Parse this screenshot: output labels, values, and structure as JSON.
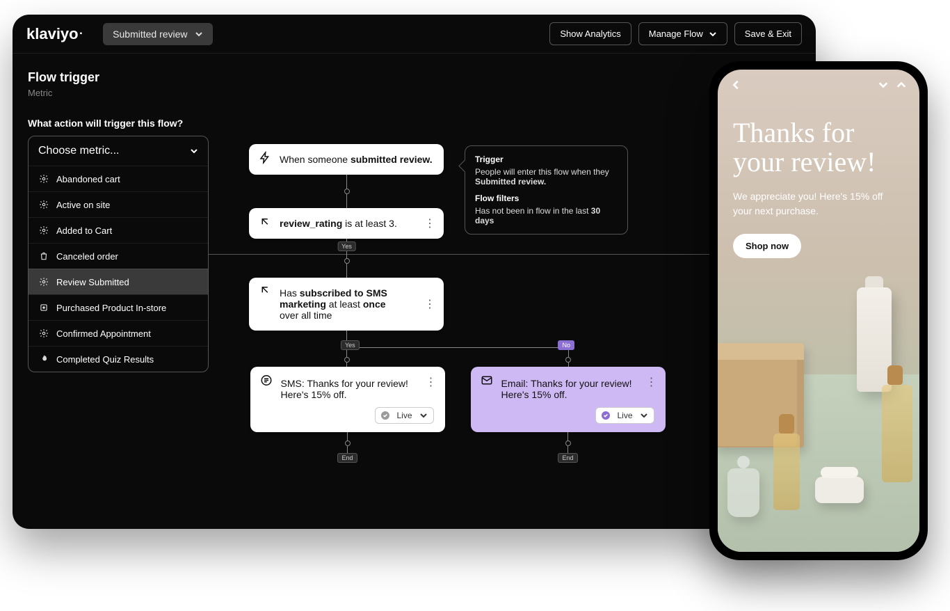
{
  "brand": "klaviyo",
  "topbar": {
    "flow_name": "Submitted review",
    "show_analytics": "Show Analytics",
    "manage_flow": "Manage Flow",
    "save_exit": "Save & Exit"
  },
  "left": {
    "title": "Flow trigger",
    "subtitle": "Metric",
    "prompt": "What action will trigger this flow?",
    "dropdown_placeholder": "Choose metric...",
    "metrics": [
      {
        "label": "Abandoned cart",
        "icon": "gear"
      },
      {
        "label": "Active on site",
        "icon": "gear"
      },
      {
        "label": "Added to Cart",
        "icon": "gear"
      },
      {
        "label": "Canceled order",
        "icon": "bag"
      },
      {
        "label": "Review Submitted",
        "icon": "gear",
        "selected": true
      },
      {
        "label": "Purchased Product In-store",
        "icon": "square"
      },
      {
        "label": "Confirmed Appointment",
        "icon": "gear"
      },
      {
        "label": "Completed Quiz Results",
        "icon": "flame"
      }
    ]
  },
  "info": {
    "trigger_heading": "Trigger",
    "trigger_text_pre": "People will enter this flow when they ",
    "trigger_text_bold": "Submitted review.",
    "filters_heading": "Flow filters",
    "filters_text_pre": "Has not been in flow in the last ",
    "filters_text_bold": "30 days"
  },
  "cards": {
    "trigger_pre": "When someone ",
    "trigger_bold": "submitted review.",
    "cond1_pre": "review_rating",
    "cond1_post": " is at least 3.",
    "cond2_line1_pre": "Has ",
    "cond2_line1_bold": "subscribed to SMS marketing",
    "cond2_line1_post": " at least ",
    "cond2_line1_bold2": "once",
    "cond2_line2": "over all time",
    "sms_msg": "SMS: Thanks for your review! Here's 15% off.",
    "email_msg": "Email: Thanks for your review! Here's 15% off.",
    "status_live": "Live",
    "yes": "Yes",
    "no": "No",
    "end": "End"
  },
  "phone": {
    "headline": "Thanks for your review!",
    "body": "We appreciate you! Here's 15% off your next purchase.",
    "cta": "Shop now"
  }
}
